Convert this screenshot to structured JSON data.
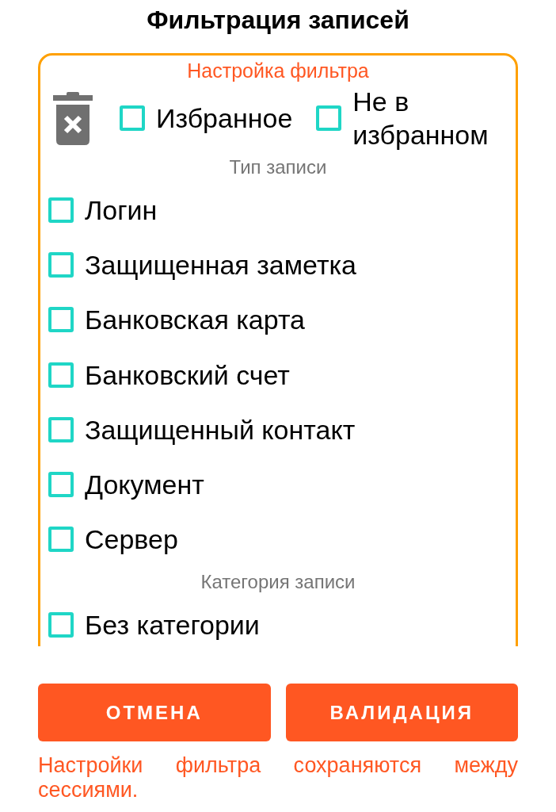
{
  "title": "Фильтрация записей",
  "filter_panel": {
    "legend": "Настройка фильтра",
    "favorite_options": [
      {
        "label": "Избранное",
        "checked": false
      },
      {
        "label": "Не в избранном",
        "checked": false
      }
    ],
    "sections": [
      {
        "heading": "Тип записи",
        "options": [
          {
            "label": "Логин",
            "checked": false
          },
          {
            "label": "Защищенная заметка",
            "checked": false
          },
          {
            "label": "Банковская карта",
            "checked": false
          },
          {
            "label": "Банковский счет",
            "checked": false
          },
          {
            "label": "Защищенный контакт",
            "checked": false
          },
          {
            "label": "Документ",
            "checked": false
          },
          {
            "label": "Сервер",
            "checked": false
          }
        ]
      },
      {
        "heading": "Категория записи",
        "options": [
          {
            "label": "Без категории",
            "checked": false
          }
        ]
      }
    ]
  },
  "buttons": [
    {
      "label": "ОТМЕНА"
    },
    {
      "label": "ВАЛИДАЦИЯ"
    }
  ],
  "footer_note": "Настройки фильтра сохраняются между сессиями."
}
